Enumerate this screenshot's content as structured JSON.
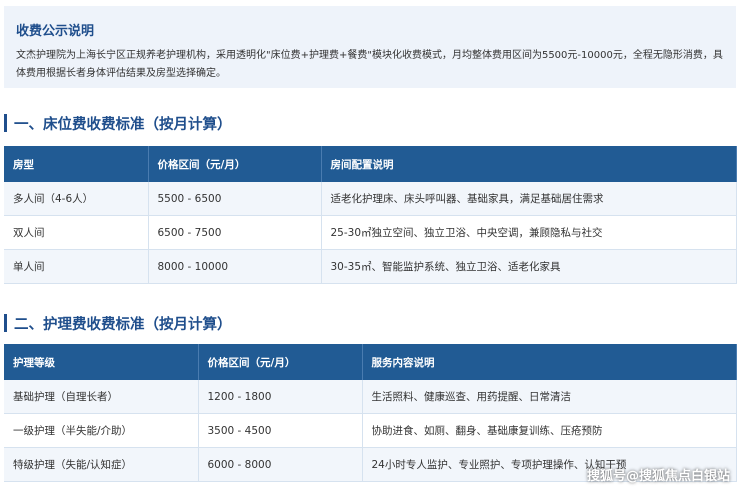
{
  "notice": {
    "title": "收费公示说明",
    "text": "文杰护理院为上海长宁区正规养老护理机构，采用透明化\"床位费+护理费+餐费\"模块化收费模式，月均整体费用区间为5500元-10000元，全程无隐形消费，具体费用根据长者身体评估结果及房型选择确定。"
  },
  "bed_section": {
    "title": "一、床位费收费标准（按月计算）",
    "headers": [
      "房型",
      "价格区间（元/月）",
      "房间配置说明"
    ],
    "rows": [
      [
        "多人间（4-6人）",
        "5500 - 6500",
        "适老化护理床、床头呼叫器、基础家具，满足基础居住需求"
      ],
      [
        "双人间",
        "6500 - 7500",
        "25-30㎡独立空间、独立卫浴、中央空调，兼顾隐私与社交"
      ],
      [
        "单人间",
        "8000 - 10000",
        "30-35㎡、智能监护系统、独立卫浴、适老化家具"
      ]
    ]
  },
  "care_section": {
    "title": "二、护理费收费标准（按月计算）",
    "headers": [
      "护理等级",
      "价格区间（元/月）",
      "服务内容说明"
    ],
    "rows": [
      [
        "基础护理（自理长者）",
        "1200 - 1800",
        "生活照料、健康巡查、用药提醒、日常清洁"
      ],
      [
        "一级护理（半失能/介助）",
        "3500 - 4500",
        "协助进食、如厕、翻身、基础康复训练、压疮预防"
      ],
      [
        "特级护理（失能/认知症）",
        "6000 - 8000",
        "24小时专人监护、专业照护、专项护理操作、认知干预"
      ]
    ]
  },
  "watermark": "搜狐号@搜狐焦点白银站"
}
